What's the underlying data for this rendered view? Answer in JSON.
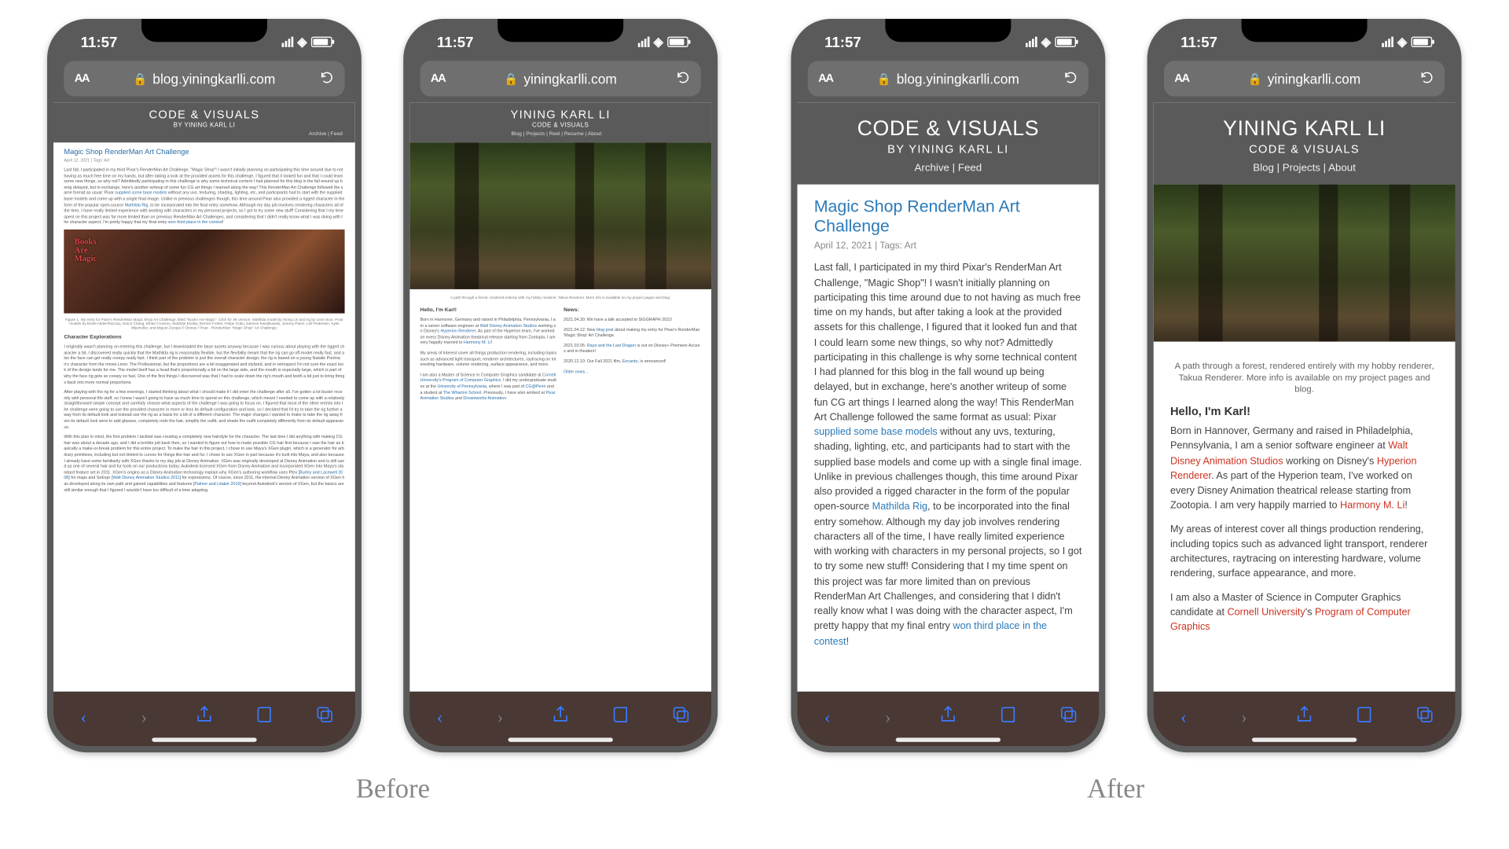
{
  "labels": {
    "before": "Before",
    "after": "After"
  },
  "status": {
    "time": "11:57"
  },
  "url": {
    "blog": "blog.yiningkarlli.com",
    "site": "yiningkarlli.com",
    "aa": "AA"
  },
  "header": {
    "blog_title": "CODE & VISUALS",
    "blog_sub": "BY YINING KARL LI",
    "blog_nav": "Archive | Feed",
    "site_title": "YINING KARL LI",
    "site_sub": "CODE & VISUALS",
    "site_nav_before": "Blog | Projects | Reel | Resume | About",
    "site_nav_after": "Blog | Projects | About"
  },
  "post": {
    "title": "Magic Shop RenderMan Art Challenge",
    "date": "April 12, 2021 | Tags: Art",
    "para1_a": "Last fall, I participated in my third Pixar's RenderMan Art Challenge, \"Magic Shop\"! I wasn't initially planning on participating this time around due to not having as much free time on my hands, but after taking a look at the provided assets for this challenge, I figured that it looked fun and that I could learn some new things, so why not? Admittedly participating in this challenge is why some technical content I had planned for this blog in the fall wound up being delayed, but in exchange, here's another writeup of some fun CG art things I learned along the way! This RenderMan Art Challenge followed the same format as usual: Pixar ",
    "link1": "supplied some base models",
    "para1_b": " without any uvs, texturing, shading, lighting, etc, and participants had to start with the supplied base models and come up with a single final image. Unlike in previous challenges though, this time around Pixar also provided a rigged character in the form of the popular open-source ",
    "link2": "Mathilda Rig",
    "para1_c": ", to be incorporated into the final entry somehow. Although my day job involves rendering characters all of the time, I have really limited experience with working with characters in my personal projects, so I got to try some new stuff! Considering that I my time spent on this project was far more limited than on previous RenderMan Art Challenges, and considering that I didn't really know what I was doing with the character aspect, I'm pretty happy that my final entry ",
    "link3": "won third place in the contest",
    "para1_end": "!",
    "fig_cap_before": "Figure 1. My entry for Pixar's RenderMan Magic Shop Art Challenge, titled \"Books Are Magic\". Click for 4K version. Mathilda model by Xiong Lin and rig by Leon Sooi. Pixar models by Emiel Abdel-Razzaq, Grace Chang, Ethan Crossno, Siobhán Ensley, Derrick Forkel, Felipe Goku, Damien Kwiatkowski, Jeremy Paton, Leif Pedersen, Kylie Wijsmuller, and Miguel Zozaya © Disney / Pixar - RenderMan \"Magic Shop\" Art Challenge.",
    "h_char": "Character Explorations",
    "books_txt": "Books\nAre\nMagic"
  },
  "site": {
    "forest_cap_before": "A path through a forest, rendered entirely with my hobby renderer, Takua Renderer. More info is available on my project pages and blog.",
    "forest_cap_after": "A path through a forest, rendered entirely with my hobby renderer, Takua Renderer. More info is available on my project pages and blog.",
    "hello": "Hello, I'm Karl!",
    "bio_a": "Born in Hannover, Germany and raised in Philadelphia, Pennsylvania, I am a senior software engineer at ",
    "wdas": "Walt Disney Animation Studios",
    "bio_b": " working on Disney's ",
    "hyperion": "Hyperion Renderer",
    "bio_c": ". As part of the Hyperion team, I've worked on every Disney Animation theatrical release starting from Zootopia. I am very happily married to ",
    "harmony": "Harmony M. Li",
    "bio_end": "!",
    "interests": "My areas of interest cover all things production rendering, including topics such as advanced light transport, renderer architectures, raytracing on interesting hardware, volume rendering, surface appearance, and more.",
    "ms_a": "I am also a Master of Science in Computer Graphics candidate at ",
    "cornell": "Cornell University",
    "ms_b": "'s ",
    "pcg": "Program of Computer Graphics",
    "news_h": "News:",
    "news1": "2021.04.30: We have a talk accepted to SIGGRAPH 2021!",
    "news2a": "2021.04.12: New ",
    "news2link": "blog post",
    "news2b": " about making my entry for Pixar's RenderMan 'Magic Shop' Art Challenge.",
    "news3a": "2021.03.05: ",
    "news3link": "Raya and the Last Dragon",
    "news3b": " is out on Disney+ Premiere Access and in theaters!",
    "news4a": "2020.12.10: Our Fall 2021 film, ",
    "news4link": "Encanto",
    "news4b": ", is announced!",
    "older": "Older news..."
  }
}
